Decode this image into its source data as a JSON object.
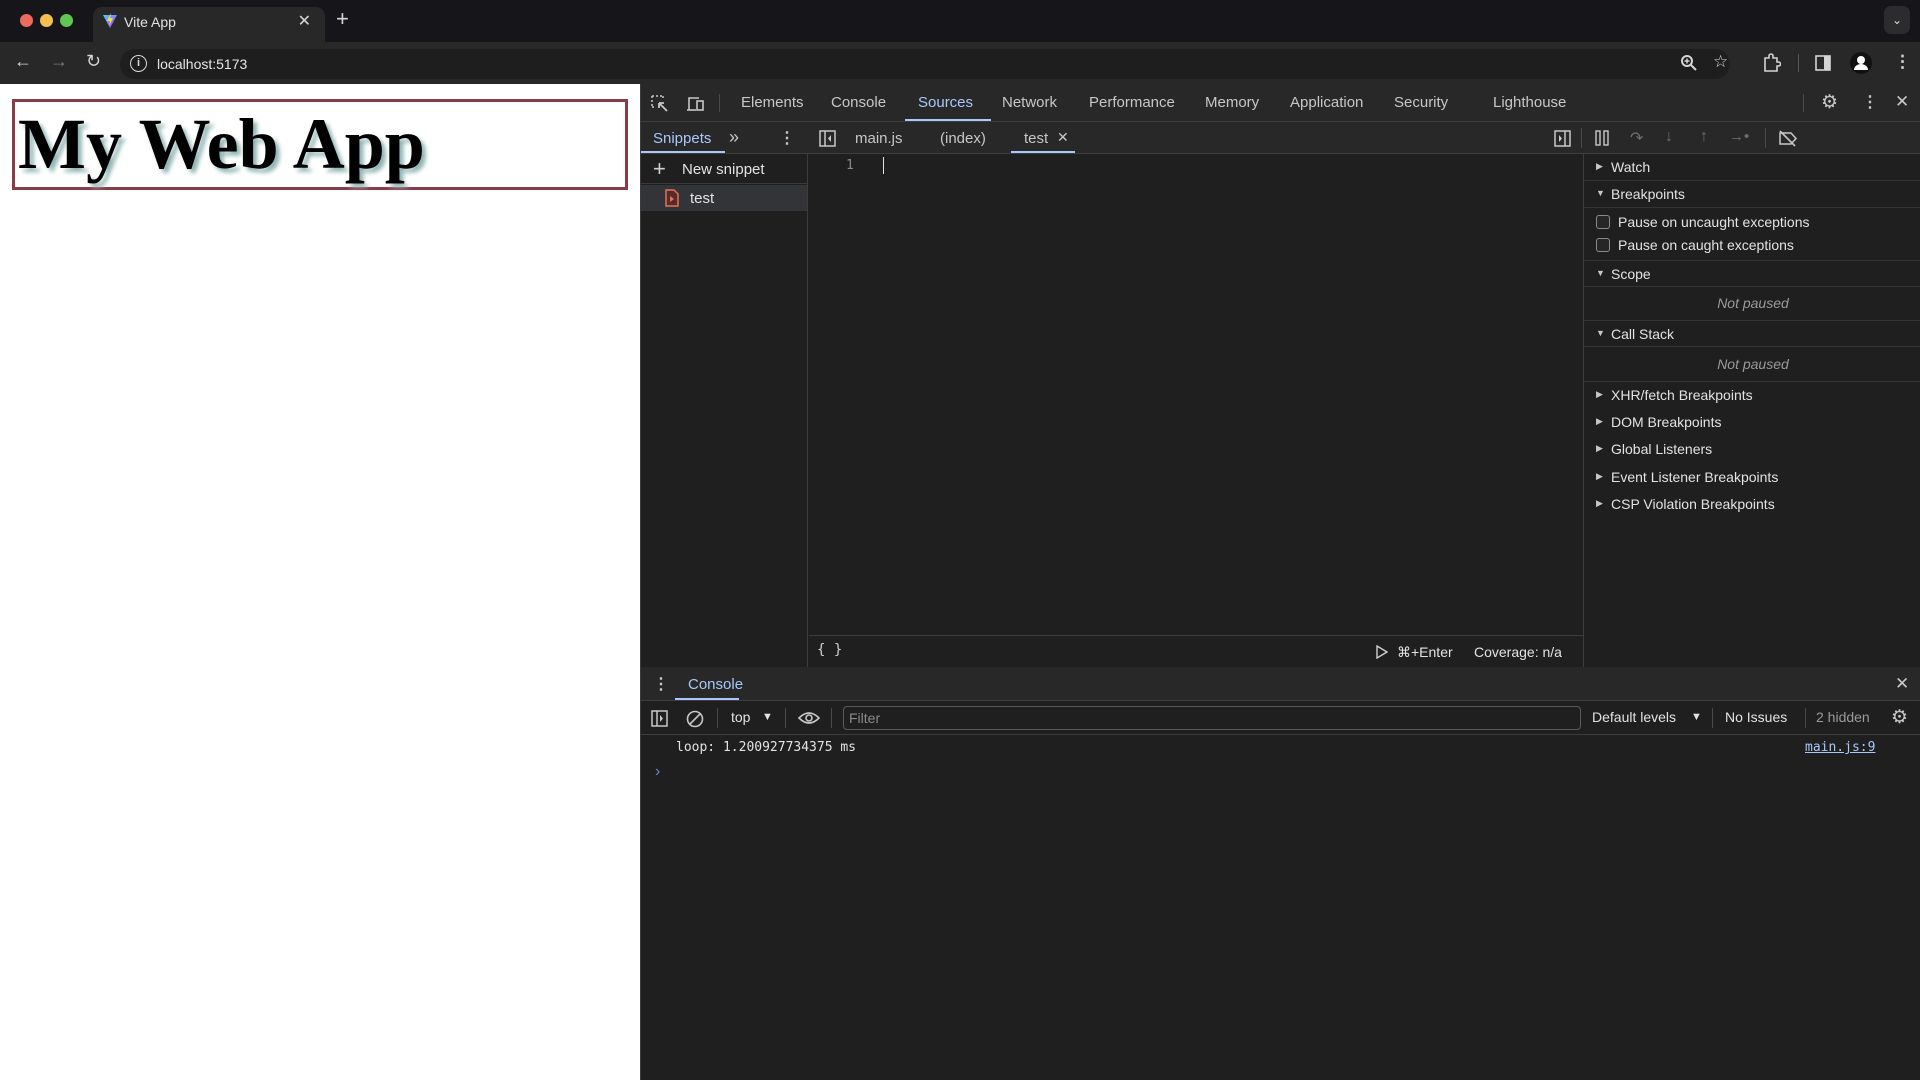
{
  "browser": {
    "tab_title": "Vite App",
    "url": "localhost:5173",
    "colors": {
      "close": "#ed6a5e",
      "minimize": "#f5bf4f",
      "maximize": "#61c554"
    }
  },
  "page": {
    "heading": "My Web App",
    "border_color": "#8b3a48"
  },
  "devtools": {
    "main_tabs": [
      {
        "label": "Elements",
        "active": false
      },
      {
        "label": "Console",
        "active": false
      },
      {
        "label": "Sources",
        "active": true
      },
      {
        "label": "Network",
        "active": false
      },
      {
        "label": "Performance",
        "active": false
      },
      {
        "label": "Memory",
        "active": false
      },
      {
        "label": "Application",
        "active": false
      },
      {
        "label": "Security",
        "active": false
      },
      {
        "label": "Lighthouse",
        "active": false
      }
    ],
    "accent": "#a8c7fa",
    "sources": {
      "navigator_tab": "Snippets",
      "more_tabs": "»",
      "open_files": [
        {
          "label": "main.js",
          "active": false
        },
        {
          "label": "(index)",
          "active": false
        },
        {
          "label": "test",
          "active": true,
          "closable": true
        }
      ],
      "new_snippet_label": "New snippet",
      "snippets": [
        {
          "label": "test"
        }
      ],
      "editor": {
        "line_numbers": [
          "1"
        ],
        "lines": [
          ""
        ]
      },
      "footer": {
        "format_icon": "{ }",
        "run_shortcut": "⌘+Enter",
        "coverage": "Coverage: n/a"
      },
      "debugger": {
        "sections": {
          "watch": "Watch",
          "breakpoints": "Breakpoints",
          "scope": "Scope",
          "call_stack": "Call Stack",
          "xhr": "XHR/fetch Breakpoints",
          "dom": "DOM Breakpoints",
          "global": "Global Listeners",
          "event": "Event Listener Breakpoints",
          "csp": "CSP Violation Breakpoints"
        },
        "pause_uncaught": {
          "label": "Pause on uncaught exceptions",
          "checked": false
        },
        "pause_caught": {
          "label": "Pause on caught exceptions",
          "checked": false
        },
        "scope_status": "Not paused",
        "call_stack_status": "Not paused"
      }
    },
    "console": {
      "drawer_tab": "Console",
      "context": "top",
      "filter_placeholder": "Filter",
      "filter_value": "",
      "levels": "Default levels",
      "issues": "No Issues",
      "hidden": "2 hidden",
      "messages": [
        {
          "text": "loop: 1.200927734375 ms",
          "source": "main.js:9"
        }
      ],
      "prompt": "›"
    }
  }
}
